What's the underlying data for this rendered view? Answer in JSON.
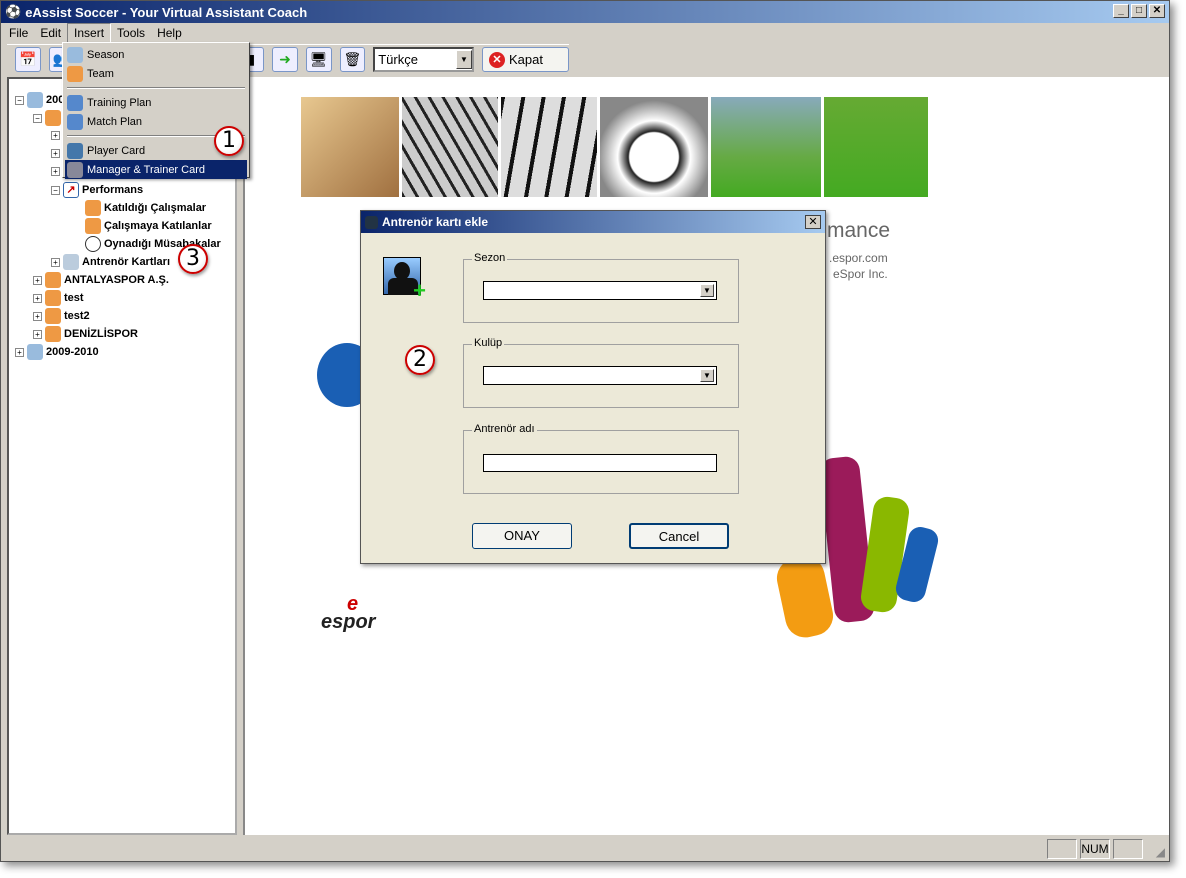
{
  "window": {
    "title": "eAssist Soccer - Your Virtual Assistant Coach",
    "controls": [
      "_",
      "□",
      "✕"
    ]
  },
  "menubar": [
    "File",
    "Edit",
    "Insert",
    "Tools",
    "Help"
  ],
  "toolbar": {
    "language": "Türkçe",
    "close_label": "Kapat"
  },
  "insert_menu": {
    "items": [
      "Season",
      "Team",
      "Training Plan",
      "Match Plan",
      "Player Card",
      "Manager & Trainer Card"
    ],
    "selected": "Manager & Trainer Card"
  },
  "tree": {
    "root1": "200",
    "performans": "Performans",
    "perf_children": [
      "Katıldığı Çalışmalar",
      "Çalışmaya Katılanlar",
      "Oynadığı Müsabakalar"
    ],
    "antrenor": "Antrenör Kartları",
    "teams": [
      "ANTALYASPOR A.Ş.",
      "test",
      "test2",
      "DENİZLİSPOR"
    ],
    "root2": "2009-2010"
  },
  "splash": {
    "heading_fragment": "mance",
    "url_fragment": ".espor.com",
    "company_fragment": "eSpor Inc.",
    "logo_text": "espor"
  },
  "dialog": {
    "title": "Antrenör kartı ekle",
    "sezon_label": "Sezon",
    "sezon_value": "",
    "kulup_label": "Kulüp",
    "kulup_value": "",
    "name_label": "Antrenör adı",
    "name_value": "",
    "ok_label": "ONAY",
    "cancel_label": "Cancel"
  },
  "badges": [
    "1",
    "2",
    "3"
  ],
  "statusbar": {
    "panels": [
      "",
      "NUM",
      ""
    ]
  },
  "colors": {
    "title_start": "#0a246a",
    "title_end": "#a6caf0",
    "selection": "#0a246a",
    "badge_border": "#cc0000"
  }
}
